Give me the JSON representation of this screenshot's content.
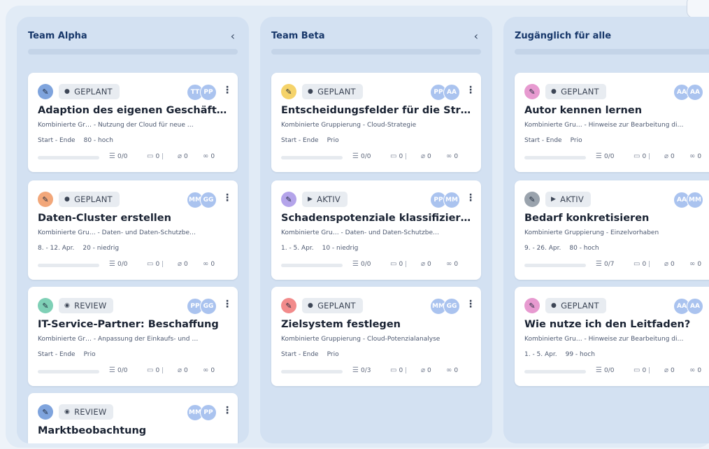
{
  "columns": [
    {
      "title": "Team Alpha",
      "collapse": "‹",
      "cards": [
        {
          "edit_color": "#7fa4dd",
          "status": "GEPLANT",
          "status_icon": "circle",
          "avatars": [
            "TT",
            "PP"
          ],
          "title": "Adaption des eigenen Geschäftsmod…",
          "subtitle": "Kombinierte Gr…  - Nutzung der Cloud für neue …",
          "dates": "Start - Ende",
          "prio": "80 - hoch",
          "checklist": "0/0",
          "comments": "0",
          "attachments": "0",
          "links": "0"
        },
        {
          "edit_color": "#f2a77a",
          "status": "GEPLANT",
          "status_icon": "circle",
          "avatars": [
            "MM",
            "GG"
          ],
          "title": "Daten-Cluster erstellen",
          "subtitle": "Kombinierte Gru…  - Daten- und Daten-Schutzbe…",
          "dates": "8. - 12. Apr.",
          "prio": "20 - niedrig",
          "checklist": "0/0",
          "comments": "0",
          "attachments": "0",
          "links": "0"
        },
        {
          "edit_color": "#7fd0b6",
          "status": "REVIEW",
          "status_icon": "eye",
          "avatars": [
            "PP",
            "GG"
          ],
          "title": "IT-Service-Partner: Beschaffung",
          "subtitle": "Kombinierte Gr…  - Anpassung der Einkaufs- und …",
          "dates": "Start - Ende",
          "prio": "Prio",
          "checklist": "0/0",
          "comments": "0",
          "attachments": "0",
          "links": "0"
        },
        {
          "edit_color": "#7fa4dd",
          "status": "REVIEW",
          "status_icon": "eye",
          "avatars": [
            "MM",
            "PP"
          ],
          "title": "Marktbeobachtung",
          "subtitle": "",
          "dates": "",
          "prio": "",
          "checklist": "",
          "comments": "",
          "attachments": "",
          "links": ""
        }
      ]
    },
    {
      "title": "Team Beta",
      "collapse": "‹",
      "cards": [
        {
          "edit_color": "#f5d36a",
          "status": "GEPLANT",
          "status_icon": "circle",
          "avatars": [
            "PP",
            "AA"
          ],
          "title": "Entscheidungsfelder für die Strategie…",
          "subtitle": "Kombinierte Gruppierung - Cloud-Strategie",
          "dates": "Start - Ende",
          "prio": "Prio",
          "checklist": "0/0",
          "comments": "0",
          "attachments": "0",
          "links": "0"
        },
        {
          "edit_color": "#b4a4ea",
          "status": "AKTIV",
          "status_icon": "play",
          "avatars": [
            "PP",
            "MM"
          ],
          "title": "Schadenspotenziale klassifizieren",
          "subtitle": "Kombinierte Gru…  - Daten- und Daten-Schutzbe…",
          "dates": "1. - 5. Apr.",
          "prio": "10 - niedrig",
          "checklist": "0/0",
          "comments": "0",
          "attachments": "0",
          "links": "0"
        },
        {
          "edit_color": "#f28b8b",
          "status": "GEPLANT",
          "status_icon": "circle",
          "avatars": [
            "MM",
            "GG"
          ],
          "title": "Zielsystem festlegen",
          "subtitle": "Kombinierte Gruppierung - Cloud-Potenzialanalyse",
          "dates": "Start - Ende",
          "prio": "Prio",
          "checklist": "0/3",
          "comments": "0",
          "attachments": "0",
          "links": "0"
        }
      ]
    },
    {
      "title": "Zugänglich für alle",
      "collapse": "",
      "cards": [
        {
          "edit_color": "#e79ad0",
          "status": "GEPLANT",
          "status_icon": "circle",
          "avatars": [
            "AA",
            "AA"
          ],
          "title": "Autor kennen lernen",
          "subtitle": "Kombinierte Gru…  - Hinweise zur Bearbeitung di…",
          "dates": "Start - Ende",
          "prio": "Prio",
          "checklist": "0/0",
          "comments": "0",
          "attachments": "0",
          "links": "0"
        },
        {
          "edit_color": "#9aa3ad",
          "status": "AKTIV",
          "status_icon": "play",
          "avatars": [
            "AA",
            "MM"
          ],
          "title": "Bedarf konkretisieren",
          "subtitle": "Kombinierte Gruppierung - Einzelvorhaben",
          "dates": "9. - 26. Apr.",
          "prio": "80 - hoch",
          "checklist": "0/7",
          "comments": "0",
          "attachments": "0",
          "links": "0"
        },
        {
          "edit_color": "#e79ad0",
          "status": "GEPLANT",
          "status_icon": "circle",
          "avatars": [
            "AA",
            "AA"
          ],
          "title": "Wie nutze ich den Leitfaden?",
          "subtitle": "Kombinierte Gru…  - Hinweise zur Bearbeitung di…",
          "dates": "1. - 5. Apr.",
          "prio": "99 - hoch",
          "checklist": "0/0",
          "comments": "0",
          "attachments": "0",
          "links": "0"
        }
      ]
    }
  ],
  "icons": {
    "edit": "pencil-icon",
    "circle": "status-circle-icon",
    "play": "play-icon",
    "eye": "eye-icon",
    "checklist": "checklist-icon",
    "comments": "comment-icon",
    "attachments": "paperclip-icon",
    "links": "link-icon",
    "menu": "kebab-menu-icon"
  },
  "colors": {
    "board": "#e1ebf6",
    "column": "#d3e1f2",
    "title": "#17376a",
    "avatar": "#aac3ef"
  }
}
